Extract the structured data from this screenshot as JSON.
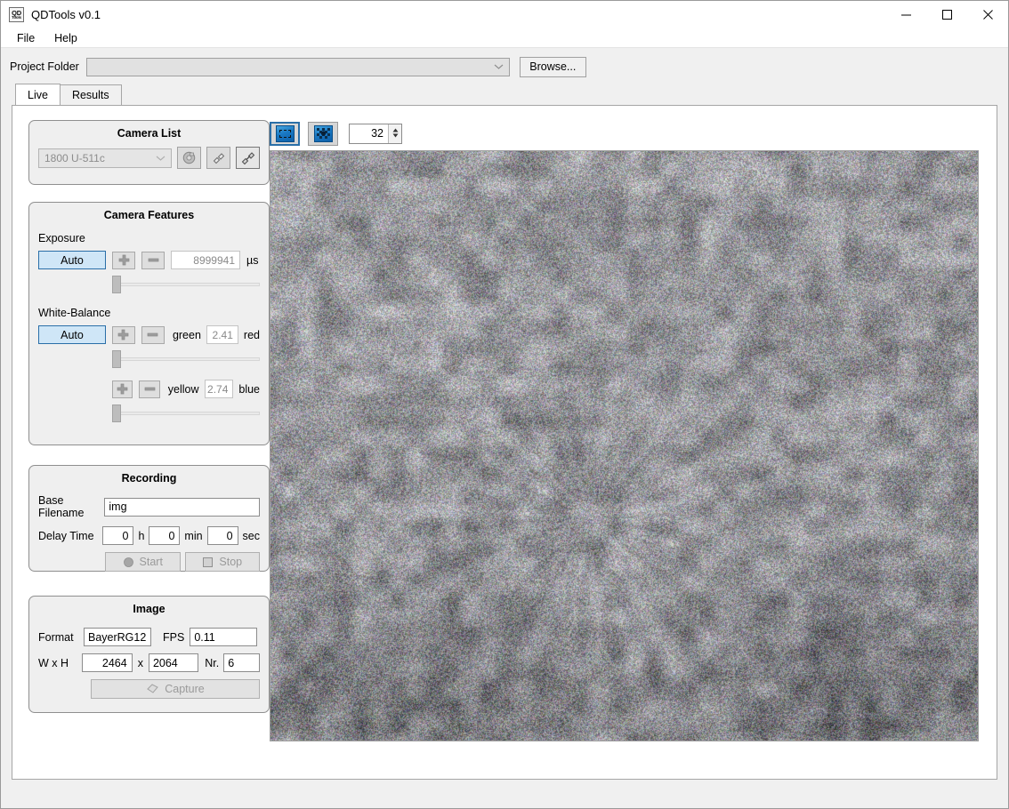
{
  "window": {
    "title": "QDTools v0.1",
    "icon_line1": "QD",
    "icon_line2": "Tools",
    "minimize": "─",
    "maximize": "□",
    "close": "✕"
  },
  "menubar": {
    "items": [
      {
        "label": "File"
      },
      {
        "label": "Help"
      }
    ]
  },
  "project": {
    "label": "Project Folder",
    "value": "",
    "placeholder": "",
    "chevron": "⌄",
    "browse_label": "Browse..."
  },
  "tabs": [
    {
      "label": "Live",
      "active": true
    },
    {
      "label": "Results",
      "active": false
    }
  ],
  "camera_list": {
    "title": "Camera List",
    "selected": "1800 U-511c",
    "chevron": "⌄",
    "buttons": [
      {
        "name": "camera-settings-icon"
      },
      {
        "name": "plug-connect-icon"
      },
      {
        "name": "plug-disconnect-icon"
      }
    ]
  },
  "camera_features": {
    "title": "Camera Features",
    "exposure": {
      "label": "Exposure",
      "auto_label": "Auto",
      "plus": "✚",
      "minus": "─",
      "value": "8999941",
      "unit": "µs",
      "slider_pct": 0
    },
    "white_balance": {
      "label": "White-Balance",
      "auto_label": "Auto",
      "rows": [
        {
          "left_label": "green",
          "value": "2.41",
          "right_label": "red",
          "slider_pct": 0
        },
        {
          "left_label": "yellow",
          "value": "2.74",
          "right_label": "blue",
          "slider_pct": 0
        }
      ]
    }
  },
  "recording": {
    "title": "Recording",
    "base_filename_label": "Base Filename",
    "base_filename": "img",
    "delay_time_label": "Delay Time",
    "hours": "0",
    "hours_unit": "h",
    "minutes": "0",
    "minutes_unit": "min",
    "seconds": "0",
    "seconds_unit": "sec",
    "start_label": "Start",
    "stop_label": "Stop"
  },
  "image": {
    "title": "Image",
    "format_label": "Format",
    "format": "BayerRG12",
    "fps_label": "FPS",
    "fps": "0.11",
    "wh_label": "W x H",
    "width": "2464",
    "x_label": "x",
    "height": "2064",
    "nr_label": "Nr.",
    "nr": "6",
    "capture_label": "Capture"
  },
  "toolbar": {
    "buttons": [
      {
        "name": "roi-select-tool",
        "selected": true
      },
      {
        "name": "pixel-zoom-tool",
        "selected": false
      }
    ],
    "spin_value": "32",
    "spin_up": "▲",
    "spin_down": "▼"
  },
  "colors": {
    "accent": "#2a6fa8",
    "auto_button_fill": "#cfe6f7",
    "group_bg": "#efefef",
    "window_bg": "#f0f0f0",
    "tool_icon_blue": "#1a79c4"
  }
}
